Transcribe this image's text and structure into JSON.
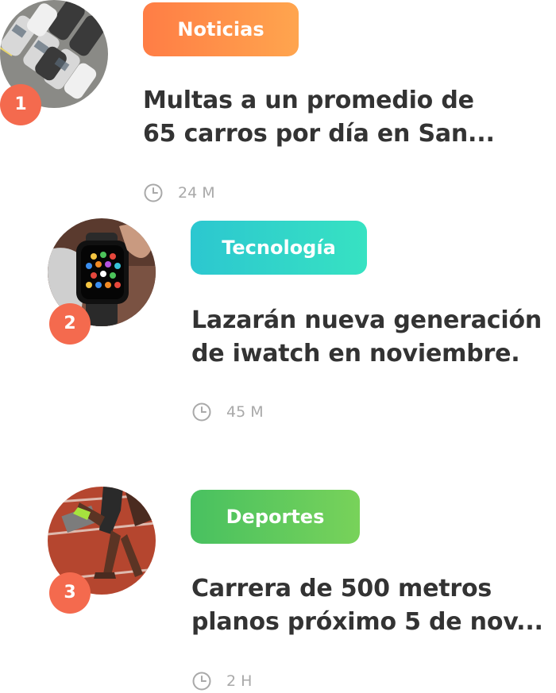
{
  "items": [
    {
      "rank": "1",
      "category": "Noticias",
      "category_color": "#ff8a4c",
      "title_line1": "Multas a un promedio de",
      "title_line2": "65 carros por día en San...",
      "time": "24 M",
      "image_icon": "parking-lot-photo"
    },
    {
      "rank": "2",
      "category": "Tecnología",
      "category_color": "#2fd3c9",
      "title_line1": "Lazarán nueva generación",
      "title_line2": "de iwatch en noviembre.",
      "time": "45 M",
      "image_icon": "smartwatch-photo"
    },
    {
      "rank": "3",
      "category": "Deportes",
      "category_color": "#5cc85e",
      "title_line1": "Carrera de 500 metros",
      "title_line2": "planos próximo 5 de nov...",
      "time": "2 H",
      "image_icon": "sprinter-photo"
    }
  ],
  "colors": {
    "rank_badge": "#f46a4e",
    "headline": "#333333",
    "meta": "#a9a9a9"
  }
}
